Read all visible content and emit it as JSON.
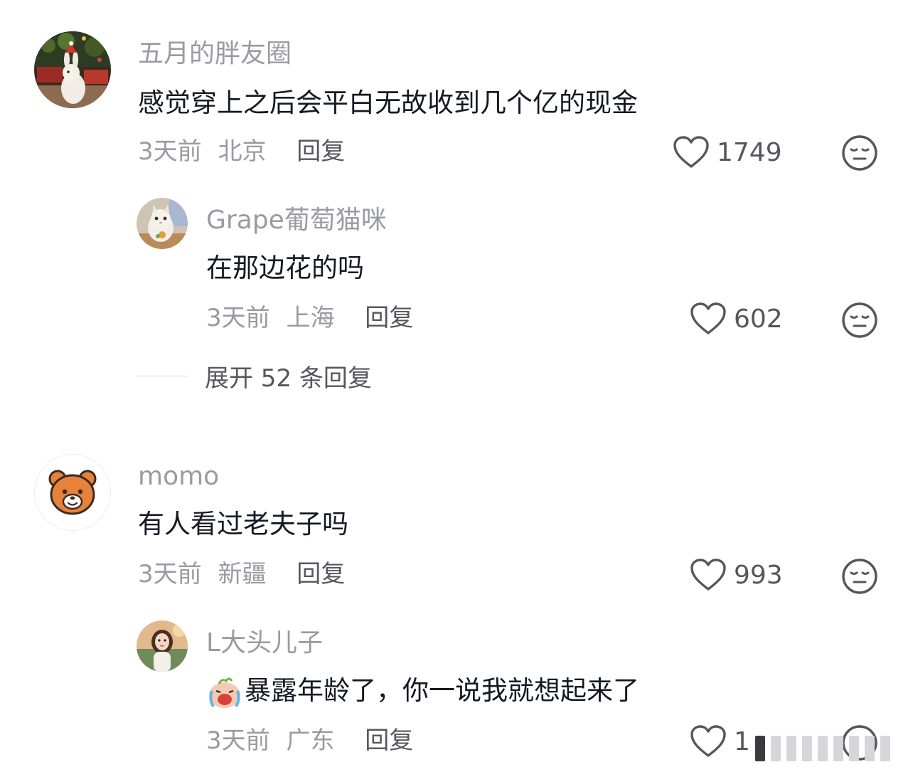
{
  "comments": [
    {
      "username": "五月的胖友圈",
      "text": "感觉穿上之后会平白无故收到几个亿的现金",
      "time": "3天前",
      "location": "北京",
      "reply_label": "回复",
      "likes": "1749"
    },
    {
      "username": "Grape葡萄猫咪",
      "text": "在那边花的吗",
      "time": "3天前",
      "location": "上海",
      "reply_label": "回复",
      "likes": "602"
    },
    {
      "username": "momo",
      "text": "有人看过老夫子吗",
      "time": "3天前",
      "location": "新疆",
      "reply_label": "回复",
      "likes": "993"
    },
    {
      "username": "L大头儿子",
      "text": "暴露年龄了，你一说我就想起来了",
      "time": "3天前",
      "location": "广东",
      "reply_label": "回复",
      "likes": "1"
    }
  ],
  "expand_replies_label": "展开 52 条回复",
  "colors": {
    "primary_text": "#161823",
    "secondary_text": "#9a9aa2",
    "action_text": "#56565e",
    "icon_stroke": "#56565e"
  },
  "icons": {
    "like": "heart-outline-icon",
    "dislike": "neutral-face-icon"
  }
}
